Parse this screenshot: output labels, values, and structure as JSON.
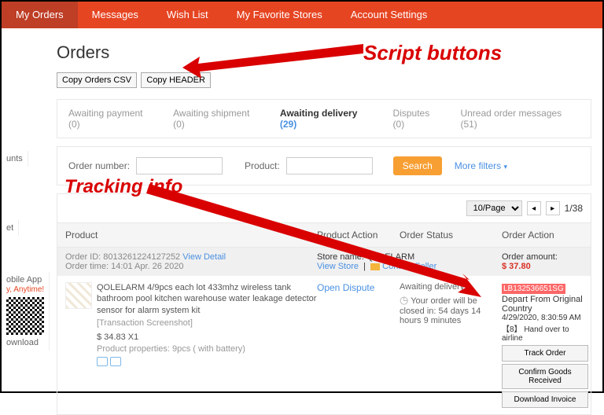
{
  "nav": {
    "tabs": [
      "My Orders",
      "Messages",
      "Wish List",
      "My Favorite Stores",
      "Account Settings"
    ],
    "activeIndex": 0
  },
  "page": {
    "title": "Orders"
  },
  "scriptButtons": {
    "csv": "Copy Orders CSV",
    "header": "Copy HEADER"
  },
  "statusTabs": {
    "items": [
      {
        "label": "Awaiting payment",
        "count": "(0)"
      },
      {
        "label": "Awaiting shipment",
        "count": "(0)"
      },
      {
        "label": "Awaiting delivery",
        "count": "(29)"
      },
      {
        "label": "Disputes",
        "count": "(0)"
      },
      {
        "label": "Unread order messages",
        "count": "(51)"
      }
    ],
    "activeIndex": 2
  },
  "filter": {
    "orderLabel": "Order number:",
    "productLabel": "Product:",
    "searchLabel": "Search",
    "moreLabel": "More filters"
  },
  "pager": {
    "pageSize": "10/Page",
    "pageText": "1/38"
  },
  "columns": {
    "product": "Product",
    "prodAction": "Product Action",
    "status": "Order Status",
    "orderAction": "Order Action"
  },
  "meta": {
    "orderIdLabel": "Order ID:",
    "orderId": "8013261224127252",
    "viewDetail": "View Detail",
    "orderTimeLabel": "Order time:",
    "orderTime": "14:01 Apr. 26 2020",
    "storeLabel": "Store name:",
    "store": "QOLELARM",
    "viewStore": "View Store",
    "contactSeller": "Contact Seller",
    "amountLabel": "Order amount:",
    "amount": "$ 37.80"
  },
  "row": {
    "productName": "QOLELARM 4/9pcs each lot 433mhz wireless tank bathroom pool kitchen warehouse water leakage detector sensor for alarm system kit",
    "transactionScreenshot": "[Transaction Screenshot]",
    "unitPrice": "$ 34.83 X1",
    "properties": "Product properties: 9pcs ( with battery)",
    "openDispute": "Open Dispute",
    "statusTitle": "Awaiting delivery",
    "statusDetail": "Your order will be closed in: 54 days 14 hours 9 minutes"
  },
  "tracking": {
    "code": "LB132536651SG",
    "status": "Depart From Original Country",
    "timestamp": "4/29/2020, 8:30:59 AM",
    "extra": "【8】 Hand over to airline",
    "btnTrack": "Track Order",
    "btnConfirm": "Confirm Goods Received",
    "btnInvoice": "Download Invoice"
  },
  "sidebar": {
    "unts": "unts",
    "et": "et",
    "app": "obile App",
    "any": "y, Anytime!",
    "dl": "ownload"
  },
  "ann": {
    "script": "Script buttons",
    "tracking": "Tracking info"
  }
}
